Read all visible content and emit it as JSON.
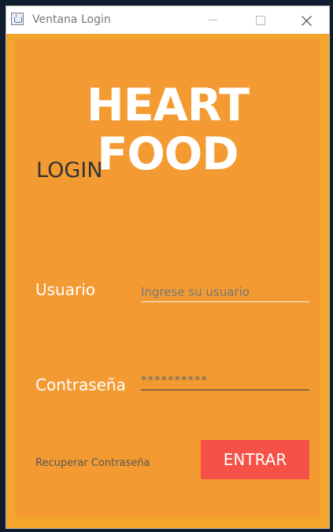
{
  "window": {
    "title": "Ventana Login"
  },
  "brand": {
    "name": "HEART FOOD"
  },
  "form": {
    "title": "LOGIN",
    "user_label": "Usuario",
    "user_placeholder": "Ingrese su usuario",
    "password_label": "Contraseña",
    "password_value": "**********",
    "recover_link": "Recuperar Contraseña",
    "submit_label": "ENTRAR"
  },
  "colors": {
    "outer_frame": "#f3a62b",
    "panel": "#f39b32",
    "button": "#f65146",
    "heading": "#ffffff",
    "dark_text": "#333333"
  }
}
